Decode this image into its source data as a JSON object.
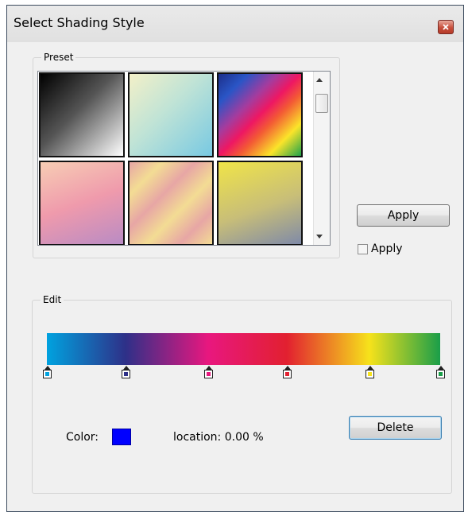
{
  "window": {
    "title": "Select Shading Style",
    "close_icon": "close-icon"
  },
  "preset": {
    "legend": "Preset",
    "swatches": [
      {
        "name": "black-white",
        "gradient": "linear-gradient(135deg, #000000 0%, #555555 45%, #ffffff 100%)"
      },
      {
        "name": "cream-cyan",
        "gradient": "linear-gradient(135deg, #f3f0c8 0%, #bfe3d6 45%, #78c9e2 100%)"
      },
      {
        "name": "rainbow",
        "gradient": "linear-gradient(135deg, #1d2f8a 0%, #2a55c6 18%, #a43c9e 36%, #ee1763 50%, #f35b34 62%, #fbe42a 80%, #1ea34a 100%)"
      },
      {
        "name": "peach-purple",
        "gradient": "linear-gradient(160deg, #f7cdb4 0%, #ef9aac 50%, #b98bc4 100%)"
      },
      {
        "name": "pastel-stripes",
        "gradient": "linear-gradient(135deg, #e7a6a5 0%, #f3dc94 20%, #e7a6a5 40%, #f3dc94 60%, #e7a6a5 80%, #f3dc94 100%)"
      },
      {
        "name": "yellow-slate",
        "gradient": "linear-gradient(160deg, #f0e448 0%, #c8be78 55%, #7f8aa8 100%)"
      }
    ]
  },
  "apply_button": {
    "label": "Apply"
  },
  "apply_checkbox": {
    "label": "Apply",
    "checked": false
  },
  "edit": {
    "legend": "Edit",
    "gradient": "linear-gradient(90deg, #00a2df 0%, #2e3088 20%, #e8177f 41%, #e22030 61%, #f6e21b 82%, #1a9e49 100%)",
    "stops": [
      {
        "location": 0,
        "color": "#00a2df"
      },
      {
        "location": 20,
        "color": "#2e3088"
      },
      {
        "location": 41,
        "color": "#e8177f"
      },
      {
        "location": 61,
        "color": "#e22030"
      },
      {
        "location": 82,
        "color": "#f6e21b"
      },
      {
        "location": 100,
        "color": "#1a9e49"
      }
    ],
    "color_label": "Color:",
    "selected_color": "#0000ff",
    "location_text": "location: 0.00  %",
    "delete_label": "Delete"
  }
}
